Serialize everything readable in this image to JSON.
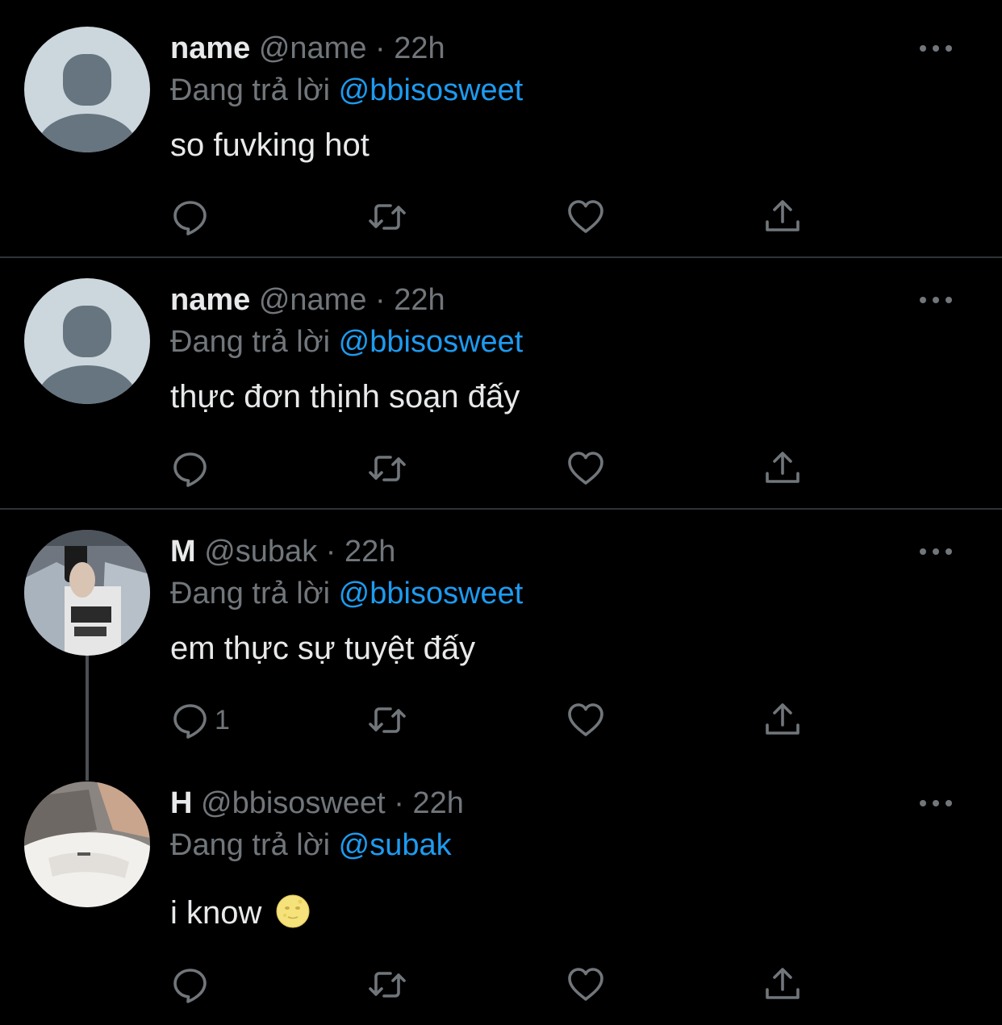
{
  "colors": {
    "background": "#000000",
    "text": "#e7e9ea",
    "secondary": "#71767b",
    "mention": "#1d9bf0",
    "divider": "#2f3336"
  },
  "replying_prefix": "Đang trả lời",
  "tweets": [
    {
      "name": "name",
      "handle": "@name",
      "dot": "·",
      "time": "22h",
      "reply_to": "@bbisosweet",
      "text": "so fuvking hot",
      "avatar": "default-avatar",
      "reply_count": ""
    },
    {
      "name": "name",
      "handle": "@name",
      "dot": "·",
      "time": "22h",
      "reply_to": "@bbisosweet",
      "text": "thực đơn thịnh soạn đấy",
      "avatar": "default-avatar",
      "reply_count": ""
    },
    {
      "name": "M",
      "handle": "@subak",
      "dot": "·",
      "time": "22h",
      "reply_to": "@bbisosweet",
      "text": "em thực sự tuyệt đấy",
      "avatar": "photo-avatar-mirror-selfie",
      "reply_count": "1"
    },
    {
      "name": "H",
      "handle": "@bbisosweet",
      "dot": "·",
      "time": "22h",
      "reply_to": "@subak",
      "text": "i know",
      "emoji": "full-moon-face",
      "avatar": "photo-avatar-white-fabric",
      "reply_count": ""
    }
  ],
  "action_icons": [
    "reply-icon",
    "retweet-icon",
    "like-icon",
    "share-icon"
  ]
}
